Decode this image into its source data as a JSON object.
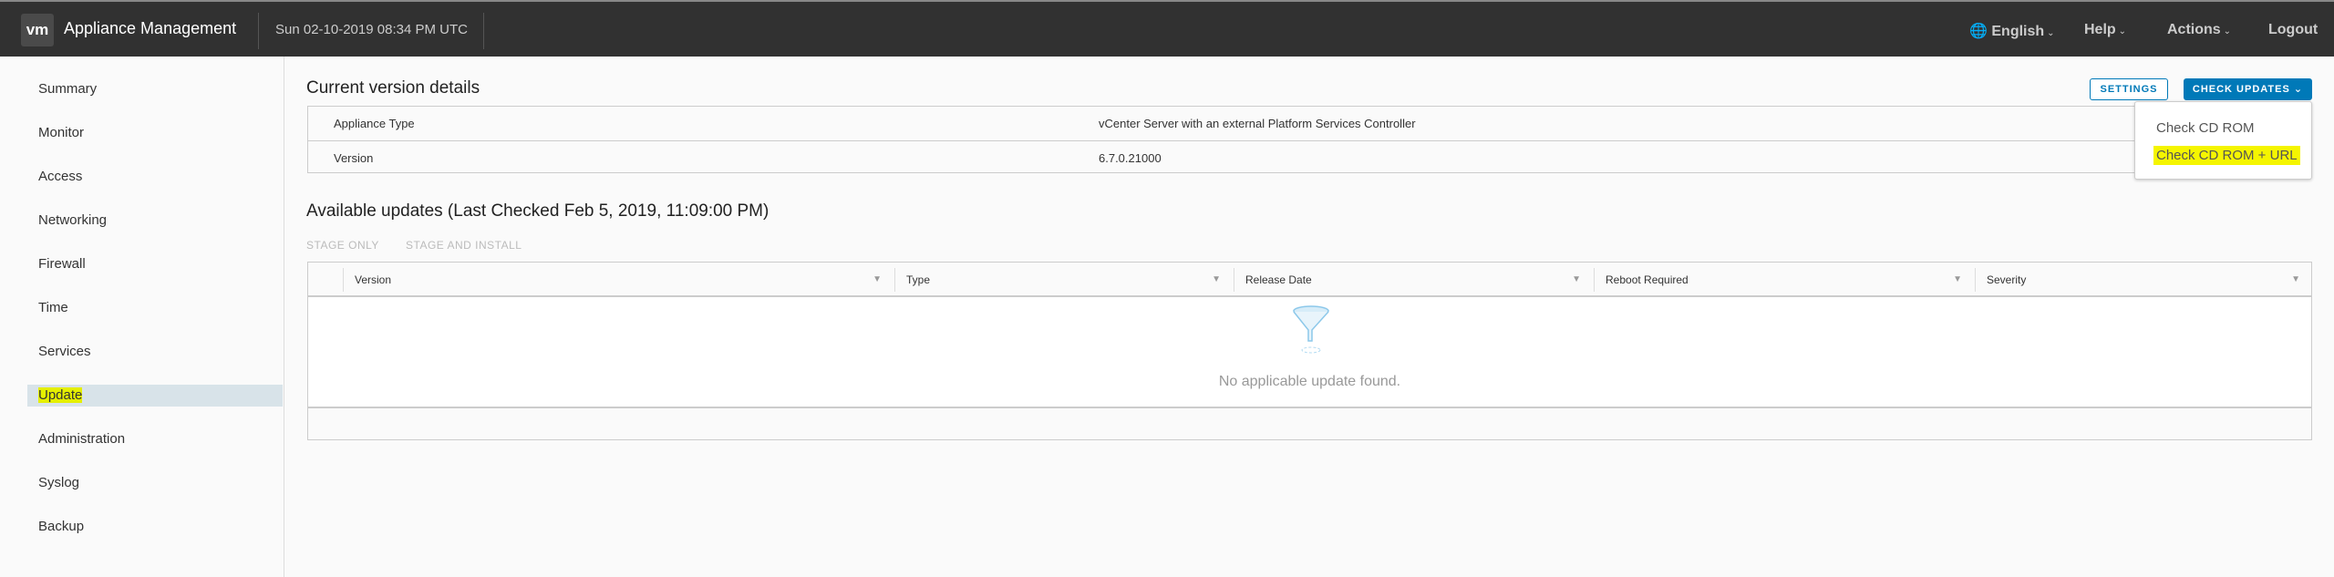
{
  "header": {
    "logo": "vm",
    "title": "Appliance Management",
    "datetime": "Sun 02-10-2019 08:34 PM UTC",
    "language": "English",
    "help": "Help",
    "actions": "Actions",
    "logout": "Logout"
  },
  "sidebar": {
    "items": [
      {
        "label": "Summary"
      },
      {
        "label": "Monitor"
      },
      {
        "label": "Access"
      },
      {
        "label": "Networking"
      },
      {
        "label": "Firewall"
      },
      {
        "label": "Time"
      },
      {
        "label": "Services"
      },
      {
        "label": "Update",
        "active": true
      },
      {
        "label": "Administration"
      },
      {
        "label": "Syslog"
      },
      {
        "label": "Backup"
      }
    ]
  },
  "current": {
    "title": "Current version details",
    "settings_label": "SETTINGS",
    "check_updates_label": "CHECK UPDATES",
    "menu": [
      "Check CD ROM",
      "Check CD ROM + URL"
    ],
    "rows": [
      {
        "key": "Appliance Type",
        "value": "vCenter Server with an external Platform Services Controller"
      },
      {
        "key": "Version",
        "value": "6.7.0.21000"
      }
    ]
  },
  "available": {
    "title": "Available updates (Last Checked Feb 5, 2019, 11:09:00 PM)",
    "stage_only": "STAGE ONLY",
    "stage_install": "STAGE AND INSTALL",
    "columns": [
      "Version",
      "Type",
      "Release Date",
      "Reboot Required",
      "Severity"
    ],
    "empty": "No applicable update found."
  },
  "colors": {
    "header_bg": "#313131",
    "accent": "#0079b8",
    "highlight": "#e5ef00"
  }
}
